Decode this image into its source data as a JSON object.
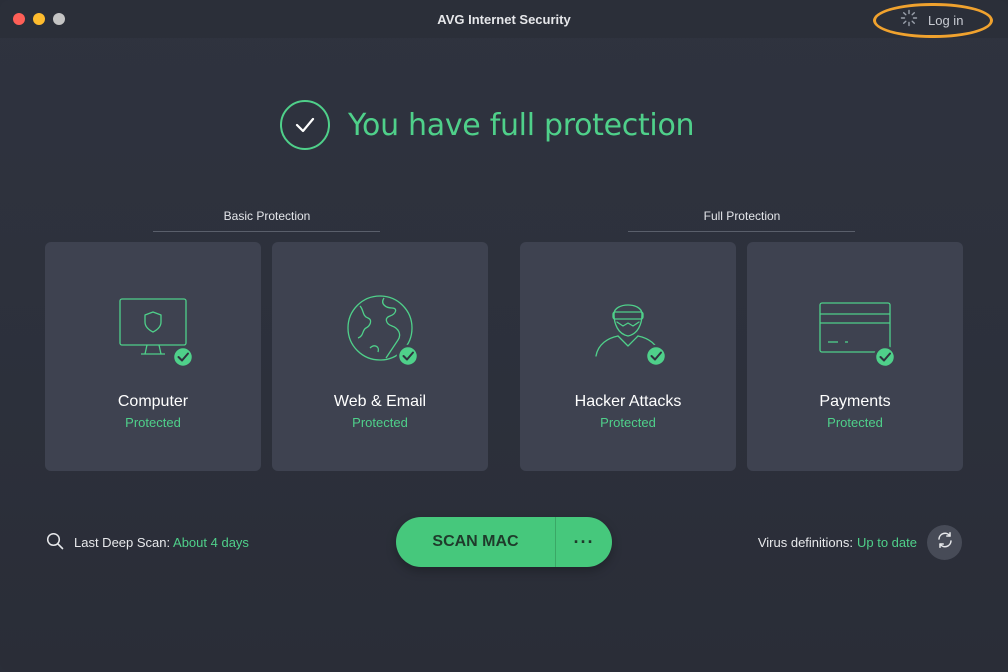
{
  "window": {
    "title": "AVG Internet Security"
  },
  "header": {
    "login_label": "Log in"
  },
  "hero": {
    "status_text": "You have full protection"
  },
  "sections": [
    {
      "label": "Basic Protection"
    },
    {
      "label": "Full Protection"
    }
  ],
  "cards": [
    {
      "title": "Computer",
      "status": "Protected",
      "icon": "monitor-shield-icon"
    },
    {
      "title": "Web & Email",
      "status": "Protected",
      "icon": "globe-icon"
    },
    {
      "title": "Hacker Attacks",
      "status": "Protected",
      "icon": "hacker-icon"
    },
    {
      "title": "Payments",
      "status": "Protected",
      "icon": "credit-card-icon"
    }
  ],
  "scan": {
    "last_scan_label": "Last Deep Scan:",
    "last_scan_value": "About 4 days",
    "button_label": "SCAN MAC",
    "more_label": "···"
  },
  "definitions": {
    "label": "Virus definitions:",
    "value": "Up to date"
  },
  "colors": {
    "accent": "#4fd08a",
    "button": "#46c87c",
    "card": "#3e4250",
    "background": "#2c303b",
    "highlight": "#f0a22e"
  }
}
